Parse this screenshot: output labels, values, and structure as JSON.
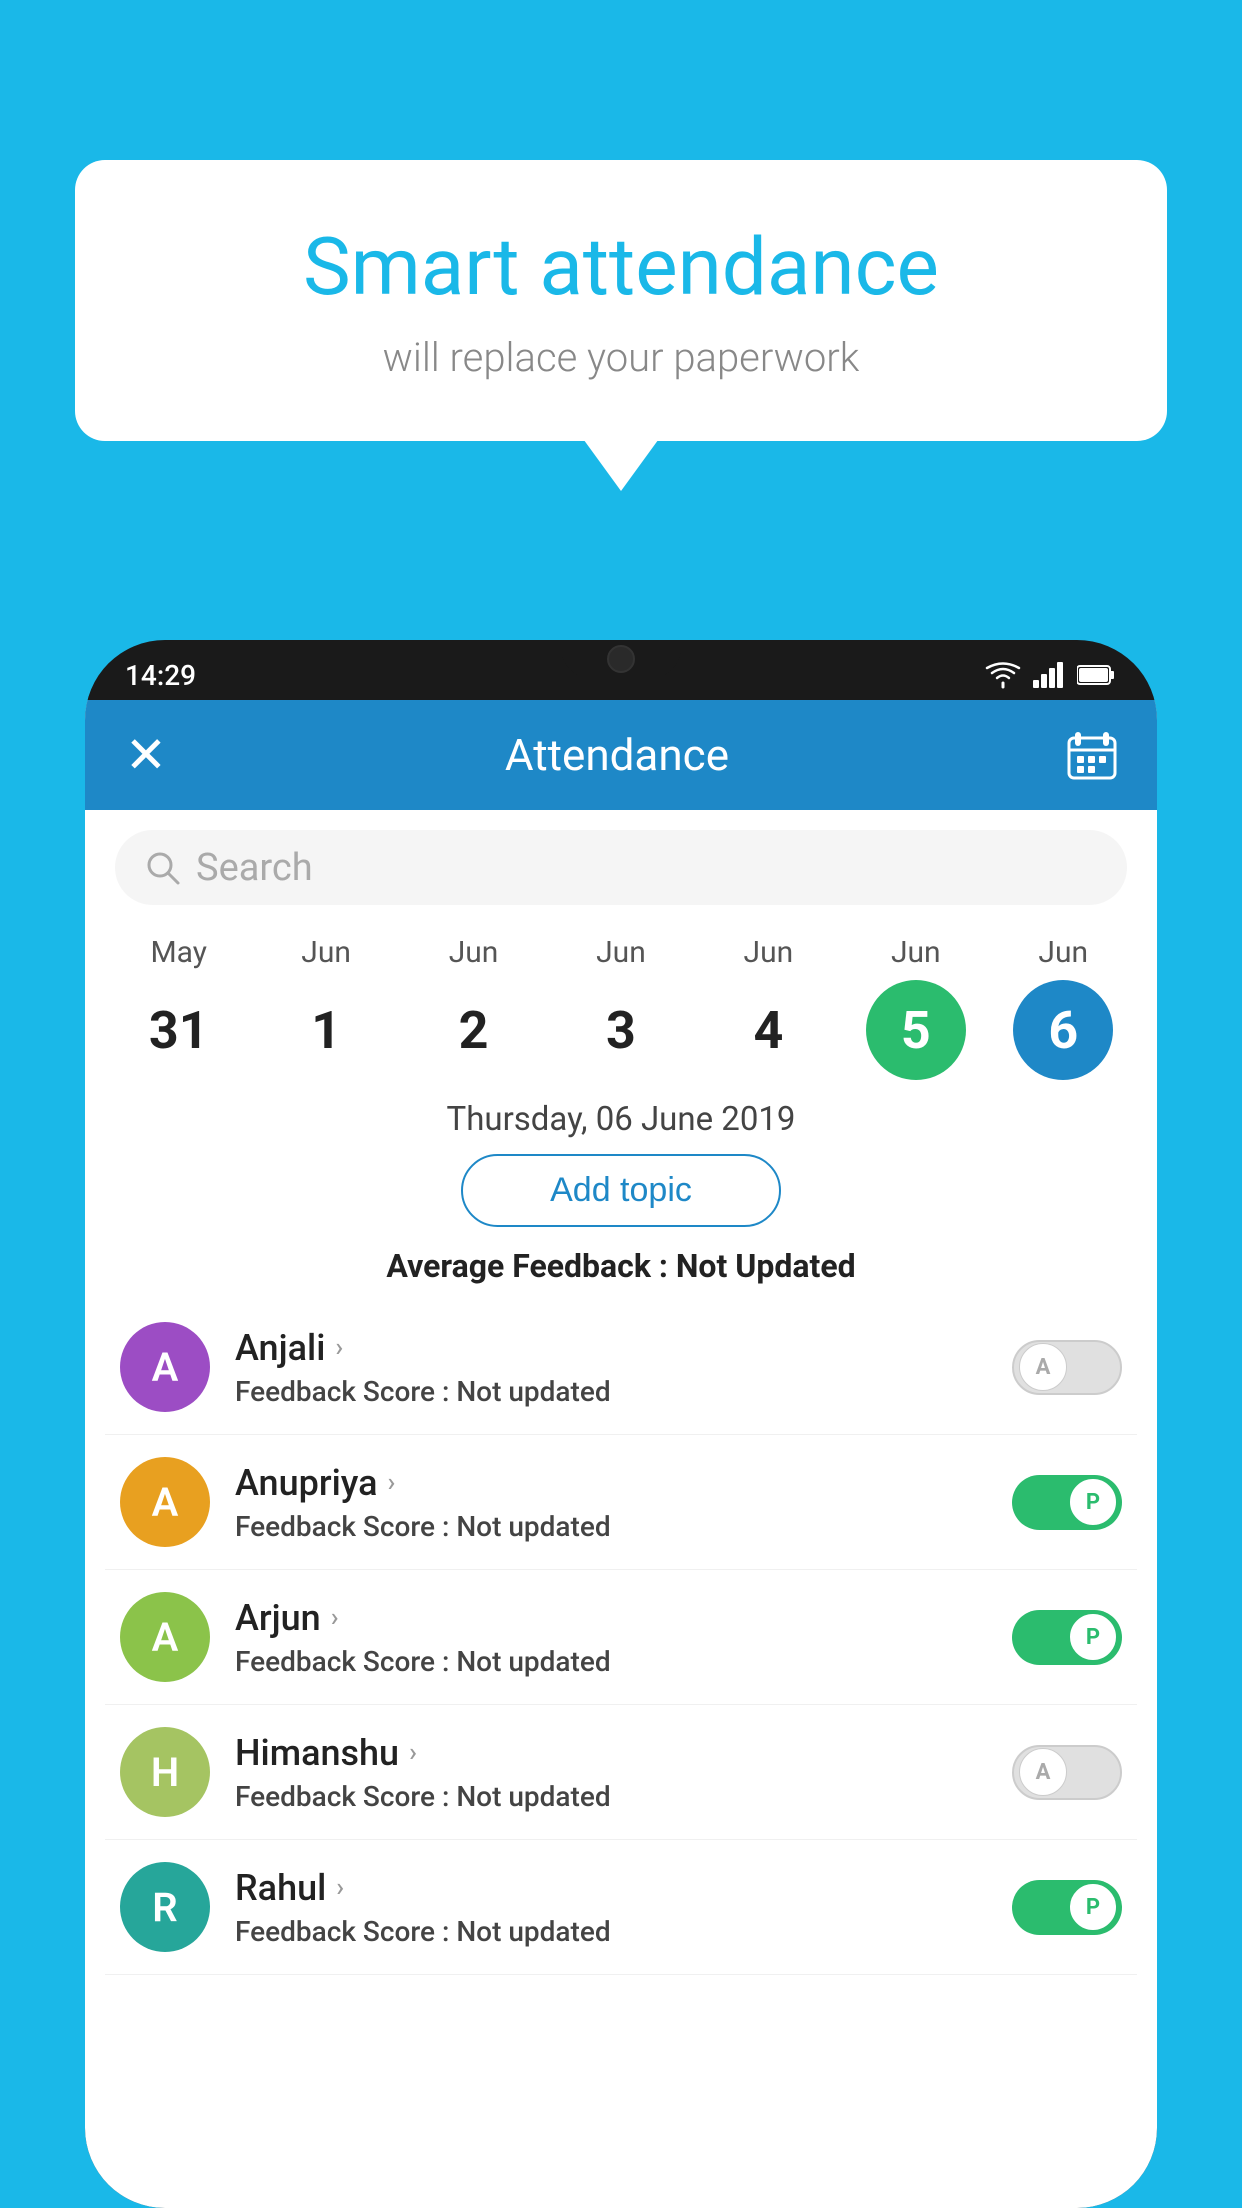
{
  "page": {
    "bg_color": "#1ab8e8"
  },
  "speech_bubble": {
    "title": "Smart attendance",
    "subtitle": "will replace your paperwork"
  },
  "status_bar": {
    "time": "14:29"
  },
  "header": {
    "title": "Attendance",
    "close_label": "✕"
  },
  "search": {
    "placeholder": "Search"
  },
  "calendar": {
    "days": [
      {
        "month": "May",
        "num": "31",
        "state": "normal"
      },
      {
        "month": "Jun",
        "num": "1",
        "state": "normal"
      },
      {
        "month": "Jun",
        "num": "2",
        "state": "normal"
      },
      {
        "month": "Jun",
        "num": "3",
        "state": "normal"
      },
      {
        "month": "Jun",
        "num": "4",
        "state": "normal"
      },
      {
        "month": "Jun",
        "num": "5",
        "state": "today"
      },
      {
        "month": "Jun",
        "num": "6",
        "state": "selected"
      }
    ]
  },
  "selected_date": "Thursday, 06 June 2019",
  "add_topic_label": "Add topic",
  "feedback_label": "Average Feedback : ",
  "feedback_value": "Not Updated",
  "students": [
    {
      "name": "Anjali",
      "avatar_letter": "A",
      "avatar_color": "#9c4dc4",
      "feedback_label": "Feedback Score : ",
      "feedback_value": "Not updated",
      "attendance": "absent",
      "toggle_label": "A"
    },
    {
      "name": "Anupriya",
      "avatar_letter": "A",
      "avatar_color": "#e8a020",
      "feedback_label": "Feedback Score : ",
      "feedback_value": "Not updated",
      "attendance": "present",
      "toggle_label": "P"
    },
    {
      "name": "Arjun",
      "avatar_letter": "A",
      "avatar_color": "#8bc34a",
      "feedback_label": "Feedback Score : ",
      "feedback_value": "Not updated",
      "attendance": "present",
      "toggle_label": "P"
    },
    {
      "name": "Himanshu",
      "avatar_letter": "H",
      "avatar_color": "#a5c462",
      "feedback_label": "Feedback Score : ",
      "feedback_value": "Not updated",
      "attendance": "absent",
      "toggle_label": "A"
    },
    {
      "name": "Rahul",
      "avatar_letter": "R",
      "avatar_color": "#26a69a",
      "feedback_label": "Feedback Score : ",
      "feedback_value": "Not updated",
      "attendance": "present",
      "toggle_label": "P"
    }
  ]
}
